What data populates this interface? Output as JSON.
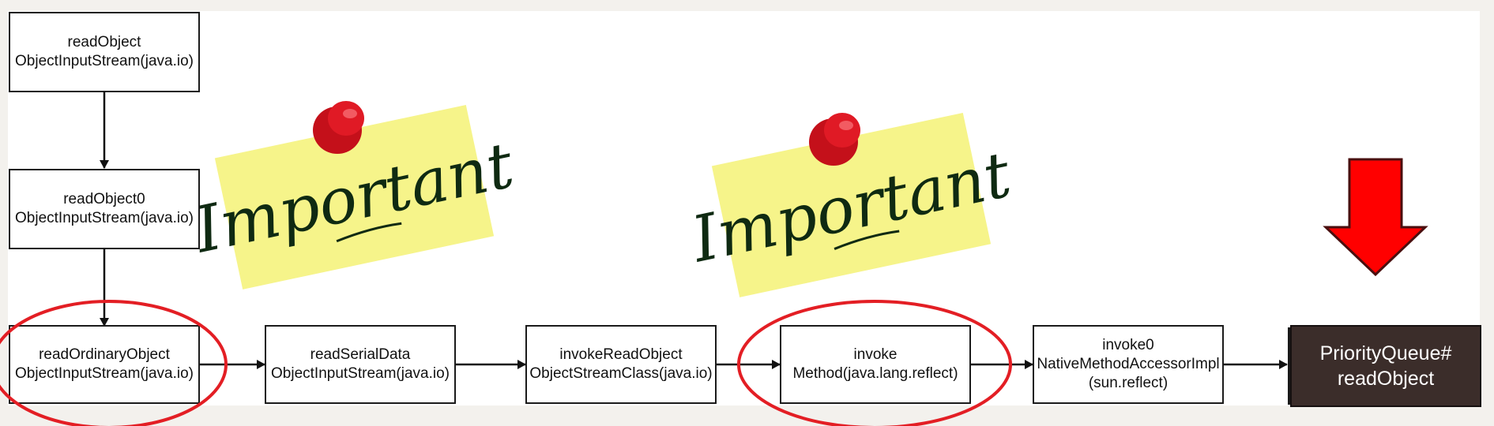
{
  "nodes": {
    "readObject": {
      "line1": "readObject",
      "line2": "ObjectInputStream(java.io)"
    },
    "readObject0": {
      "line1": "readObject0",
      "line2": "ObjectInputStream(java.io)"
    },
    "readOrdinaryObject": {
      "line1": "readOrdinaryObject",
      "line2": "ObjectInputStream(java.io)"
    },
    "readSerialData": {
      "line1": "readSerialData",
      "line2": "ObjectInputStream(java.io)"
    },
    "invokeReadObject": {
      "line1": "invokeReadObject",
      "line2": "ObjectStreamClass(java.io)"
    },
    "invoke": {
      "line1": "invoke",
      "line2": "Method(java.lang.reflect)"
    },
    "invoke0": {
      "line1": "invoke0",
      "line2": "NativeMethodAccessorImpl",
      "line3": "(sun.reflect)"
    },
    "priorityQueue": {
      "line1": "PriorityQueue#",
      "line2": "readObject"
    }
  },
  "sticky_notes": {
    "note1": {
      "text": "Important"
    },
    "note2": {
      "text": "Important"
    }
  },
  "colors": {
    "highlight_ellipse": "#e31e24",
    "pointer_arrow": "#ff0000",
    "sticky_note": "#f6f48a",
    "pushpin": "#d6111d",
    "dark_node": "#3b2d2a",
    "border": "#1b1b1b"
  },
  "icons": [
    "pushpin-icon",
    "down-arrow-icon"
  ]
}
